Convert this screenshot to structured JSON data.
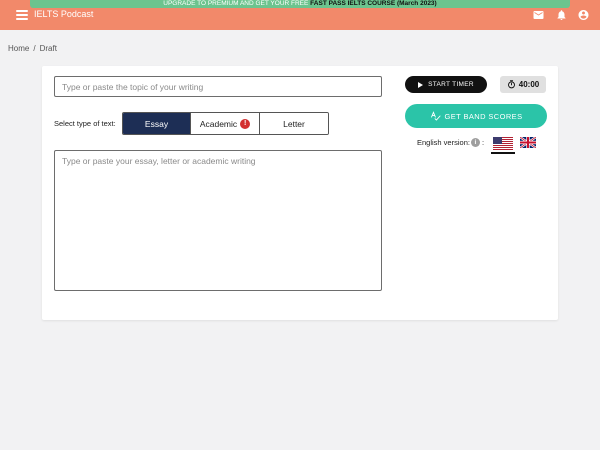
{
  "promo": {
    "text_prefix": "UPGRADE TO PREMIUM AND GET YOUR FREE ",
    "text_bold": "FAST PASS IELTS COURSE (March 2023)"
  },
  "header": {
    "title": "IELTS Podcast",
    "icons": [
      "menu-icon",
      "mail-icon",
      "bell-icon",
      "account-icon"
    ],
    "background_color": "#f2896a",
    "promo_color": "#6cc48e"
  },
  "breadcrumb": {
    "home": "Home",
    "separator": "/",
    "current": "Draft"
  },
  "editor": {
    "topic_placeholder": "Type or paste the topic of your writing",
    "type_label": "Select type of text:",
    "types": [
      "Essay",
      "Academic",
      "Letter"
    ],
    "selected_type": "Essay",
    "academic_badge": "!",
    "essay_placeholder": "Type or paste your essay, letter or academic writing",
    "active_color": "#1d2e55"
  },
  "sidebar": {
    "start_timer_label": "START TIMER",
    "timer_value": "40:00",
    "band_button_label": "GET BAND SCORES",
    "band_button_color": "#2bc4a8",
    "english_label": "English version:",
    "info_badge": "i",
    "flags": [
      "us-flag-icon",
      "uk-flag-icon"
    ],
    "selected_flag": "us-flag-icon"
  }
}
